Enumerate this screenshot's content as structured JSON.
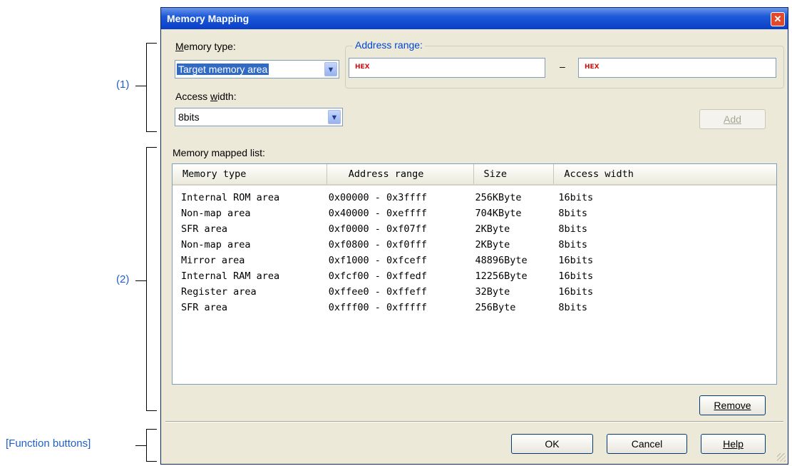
{
  "annotations": {
    "label_1": "(1)",
    "label_2": "(2)",
    "label_function": "[Function buttons]"
  },
  "dialog": {
    "title": "Memory Mapping",
    "close_glyph": "✕"
  },
  "memory_type": {
    "label_prefix": "",
    "label_accel": "M",
    "label_rest": "emory type:",
    "value": "Target memory area"
  },
  "access_width": {
    "label_prefix": "Access ",
    "label_accel": "w",
    "label_rest": "idth:",
    "value": "8bits"
  },
  "address_range": {
    "title": "Address range:",
    "start_placeholder": "HEX",
    "end_placeholder": "HEX",
    "dash": "–"
  },
  "buttons": {
    "add": "Add",
    "remove": "Remove",
    "ok": "OK",
    "cancel": "Cancel",
    "help": "Help"
  },
  "list": {
    "label": "Memory mapped list:",
    "columns": [
      "Memory type",
      "Address range",
      "Size",
      "Access width"
    ],
    "rows": [
      [
        "Internal ROM area",
        "0x00000 - 0x3ffff",
        "256KByte",
        "16bits"
      ],
      [
        "Non-map area",
        "0x40000 - 0xeffff",
        "704KByte",
        "8bits"
      ],
      [
        "SFR area",
        "0xf0000 - 0xf07ff",
        "2KByte",
        "8bits"
      ],
      [
        "Non-map area",
        "0xf0800 - 0xf0fff",
        "2KByte",
        "8bits"
      ],
      [
        "Mirror area",
        "0xf1000 - 0xfceff",
        "48896Byte",
        "16bits"
      ],
      [
        "Internal RAM area",
        "0xfcf00 - 0xffedf",
        "12256Byte",
        "16bits"
      ],
      [
        "Register area",
        "0xffee0 - 0xffeff",
        "32Byte",
        "16bits"
      ],
      [
        "SFR area",
        "0xfff00 - 0xfffff",
        "256Byte",
        "8bits"
      ]
    ]
  },
  "colors": {
    "annotation": "#1f5fc8",
    "group_title": "#0046d5",
    "hex_hint": "#d01010",
    "selection": "#316ac5"
  }
}
